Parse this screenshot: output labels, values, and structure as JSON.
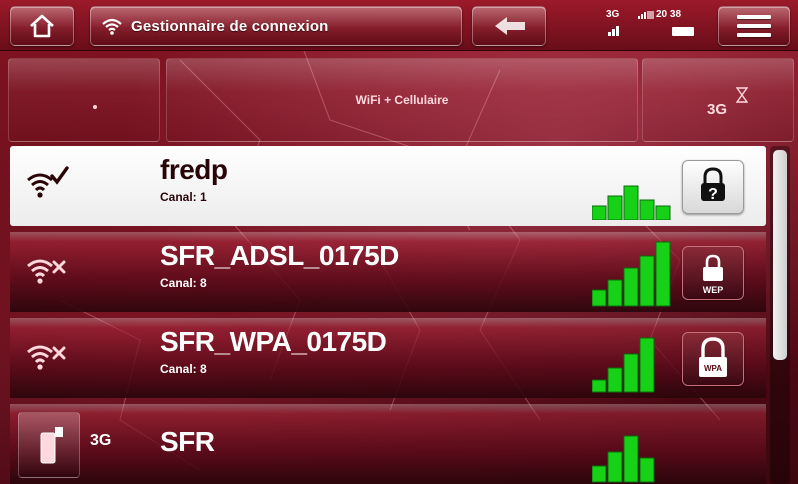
{
  "header": {
    "title": "Gestionnaire de connexion",
    "network_type": "3G",
    "clock": "20 38",
    "icons": {
      "home": "home-icon",
      "wifi": "wifi-icon",
      "back": "back-arrow-icon",
      "menu": "menu-icon"
    }
  },
  "tabs": {
    "middle_label": "WiFi + Cellulaire",
    "right_label": "3G"
  },
  "networks": [
    {
      "ssid": "fredp",
      "channel": "Canal: 1",
      "status": "connected",
      "security": "unknown",
      "signal_bars": 3,
      "selected": true
    },
    {
      "ssid": "SFR_ADSL_0175D",
      "channel": "Canal: 8",
      "status": "disconnected",
      "security": "WEP",
      "signal_bars": 4,
      "selected": false
    },
    {
      "ssid": "SFR_WPA_0175D",
      "channel": "Canal: 8",
      "status": "disconnected",
      "security": "WPA",
      "signal_bars": 3,
      "selected": false
    },
    {
      "ssid": "SFR",
      "type": "3G",
      "signal_bars": 3,
      "selected": false
    }
  ],
  "lock_labels": {
    "wep": "WEP",
    "wpa": "WPA"
  },
  "colors": {
    "accent": "#8a1424",
    "signal_green": "#17d117",
    "selected_row": "#ffffff"
  },
  "scrollbar": {
    "visible_fraction": 0.62
  }
}
